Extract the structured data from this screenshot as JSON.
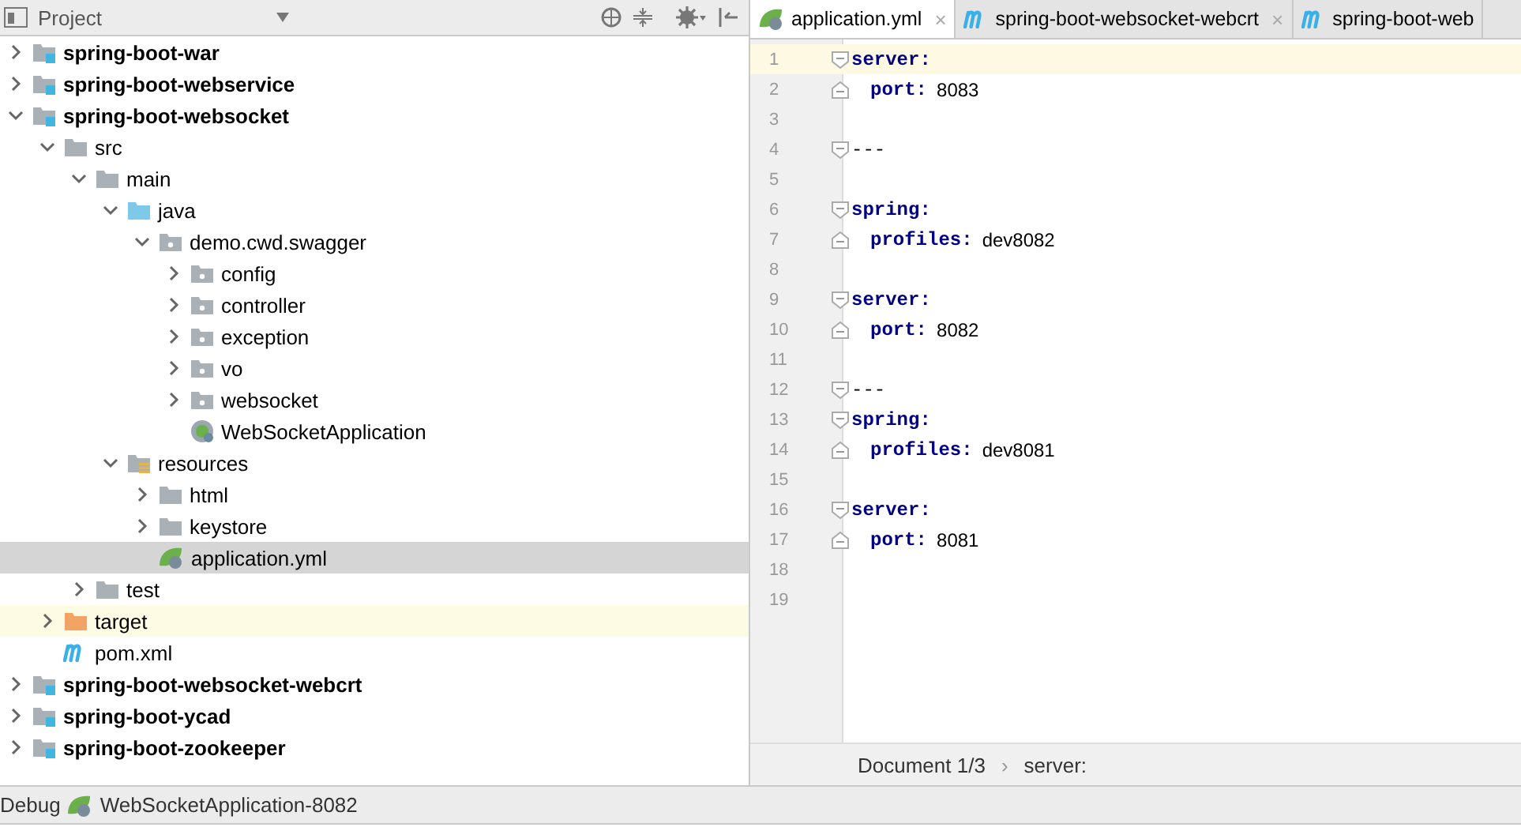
{
  "project_panel": {
    "title": "Project",
    "tree": [
      {
        "label": "spring-boot-war",
        "kind": "module",
        "expanded": false,
        "selected": false,
        "highlighted": false
      },
      {
        "label": "spring-boot-webservice",
        "kind": "module",
        "expanded": false,
        "selected": false,
        "highlighted": false
      },
      {
        "label": "spring-boot-websocket",
        "kind": "module",
        "expanded": true,
        "selected": false,
        "highlighted": false,
        "children": [
          {
            "label": "src",
            "kind": "folder",
            "expanded": true,
            "selected": false,
            "highlighted": false,
            "children": [
              {
                "label": "main",
                "kind": "folder",
                "expanded": true,
                "selected": false,
                "highlighted": false,
                "children": [
                  {
                    "label": "java",
                    "kind": "source",
                    "expanded": true,
                    "selected": false,
                    "highlighted": false,
                    "children": [
                      {
                        "label": "demo.cwd.swagger",
                        "kind": "package",
                        "expanded": true,
                        "selected": false,
                        "highlighted": false,
                        "children": [
                          {
                            "label": "config",
                            "kind": "package",
                            "expanded": false,
                            "selected": false,
                            "highlighted": false
                          },
                          {
                            "label": "controller",
                            "kind": "package",
                            "expanded": false,
                            "selected": false,
                            "highlighted": false
                          },
                          {
                            "label": "exception",
                            "kind": "package",
                            "expanded": false,
                            "selected": false,
                            "highlighted": false
                          },
                          {
                            "label": "vo",
                            "kind": "package",
                            "expanded": false,
                            "selected": false,
                            "highlighted": false
                          },
                          {
                            "label": "websocket",
                            "kind": "package",
                            "expanded": false,
                            "selected": false,
                            "highlighted": false
                          },
                          {
                            "label": "WebSocketApplication",
                            "kind": "spring",
                            "selected": false,
                            "highlighted": false
                          }
                        ]
                      }
                    ]
                  },
                  {
                    "label": "resources",
                    "kind": "resources",
                    "expanded": true,
                    "selected": false,
                    "highlighted": false,
                    "children": [
                      {
                        "label": "html",
                        "kind": "folder",
                        "expanded": false,
                        "selected": false,
                        "highlighted": false
                      },
                      {
                        "label": "keystore",
                        "kind": "folder",
                        "expanded": false,
                        "selected": false,
                        "highlighted": false
                      },
                      {
                        "label": "application.yml",
                        "kind": "yml",
                        "selected": true,
                        "highlighted": false
                      }
                    ]
                  }
                ]
              },
              {
                "label": "test",
                "kind": "folder",
                "expanded": false,
                "selected": false,
                "highlighted": false
              }
            ]
          },
          {
            "label": "target",
            "kind": "excluded",
            "expanded": false,
            "selected": false,
            "highlighted": true
          },
          {
            "label": "pom.xml",
            "kind": "maven",
            "selected": false,
            "highlighted": false
          }
        ]
      },
      {
        "label": "spring-boot-websocket-webcrt",
        "kind": "module",
        "expanded": false,
        "selected": false,
        "highlighted": false
      },
      {
        "label": "spring-boot-ycad",
        "kind": "module",
        "expanded": false,
        "selected": false,
        "highlighted": false
      },
      {
        "label": "spring-boot-zookeeper",
        "kind": "module",
        "expanded": false,
        "selected": false,
        "highlighted": false
      }
    ]
  },
  "editor": {
    "tabs": [
      {
        "label": "application.yml",
        "kind": "yml",
        "selected": true,
        "close": "×"
      },
      {
        "label": "spring-boot-websocket-webcrt",
        "kind": "maven",
        "selected": false,
        "close": "×"
      },
      {
        "label": "spring-boot-web",
        "kind": "maven",
        "selected": false
      }
    ],
    "lines": [
      {
        "number": "1",
        "key": "server:",
        "nested": false,
        "fold_start": true,
        "current": true
      },
      {
        "number": "2",
        "key": "port:",
        "value": "8083",
        "nested": true,
        "fold_start": false,
        "current": false
      },
      {
        "number": "3",
        "current": false
      },
      {
        "number": "4",
        "separator": "---",
        "fold_start": true,
        "current": false
      },
      {
        "number": "5",
        "current": false
      },
      {
        "number": "6",
        "key": "spring:",
        "nested": false,
        "fold_start": true,
        "current": false
      },
      {
        "number": "7",
        "key": "profiles:",
        "value": "dev8082",
        "nested": true,
        "fold_start": false,
        "current": false
      },
      {
        "number": "8",
        "current": false
      },
      {
        "number": "9",
        "key": "server:",
        "nested": false,
        "fold_start": true,
        "current": false
      },
      {
        "number": "10",
        "key": "port:",
        "value": "8082",
        "nested": true,
        "fold_start": false,
        "current": false
      },
      {
        "number": "11",
        "current": false
      },
      {
        "number": "12",
        "separator": "---",
        "fold_start": true,
        "current": false
      },
      {
        "number": "13",
        "key": "spring:",
        "nested": false,
        "fold_start": true,
        "current": false
      },
      {
        "number": "14",
        "key": "profiles:",
        "value": "dev8081",
        "nested": true,
        "fold_start": false,
        "current": false
      },
      {
        "number": "15",
        "current": false
      },
      {
        "number": "16",
        "key": "server:",
        "nested": false,
        "fold_start": true,
        "current": false
      },
      {
        "number": "17",
        "key": "port:",
        "value": "8081",
        "nested": true,
        "fold_start": false,
        "current": false
      },
      {
        "number": "18",
        "current": false
      },
      {
        "number": "19",
        "current": false
      }
    ],
    "breadcrumbs": [
      "Document 1/3",
      "server:"
    ],
    "breadcrumb_separator": "›"
  },
  "debug_bar": {
    "label": "Debug",
    "config": "WebSocketApplication-8082"
  }
}
